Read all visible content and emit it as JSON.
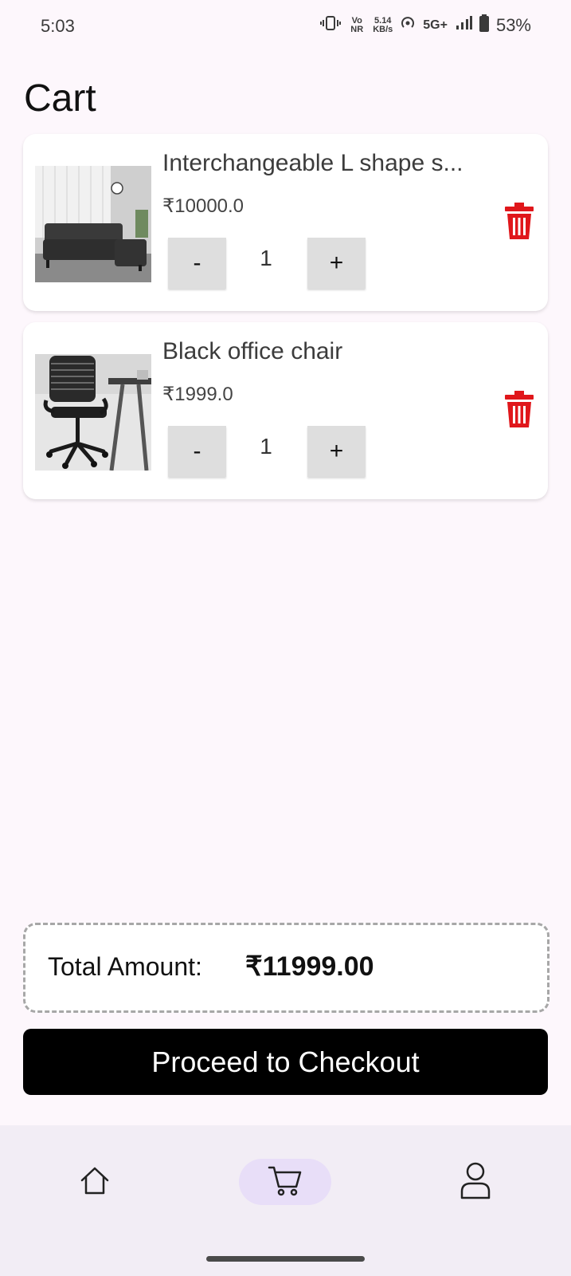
{
  "status_bar": {
    "time": "5:03",
    "volte": "Vo NR",
    "speed_value": "5.14",
    "speed_unit": "KB/s",
    "network": "5G+",
    "battery": "53%",
    "icons": [
      "vibrate-icon",
      "hotspot-icon",
      "signal-icon",
      "battery-icon"
    ]
  },
  "page": {
    "title": "Cart"
  },
  "cart": {
    "items": [
      {
        "name": "Interchangeable L shape s...",
        "price": "₹10000.0",
        "quantity": "1",
        "minus_label": "-",
        "plus_label": "+",
        "image": "sofa-photo"
      },
      {
        "name": "Black office chair",
        "price": "₹1999.0",
        "quantity": "1",
        "minus_label": "-",
        "plus_label": "+",
        "image": "office-chair-photo"
      }
    ]
  },
  "summary": {
    "total_label": "Total Amount:",
    "total_value": "₹11999.00"
  },
  "checkout": {
    "label": "Proceed to Checkout"
  },
  "nav": {
    "items": [
      {
        "icon": "home-icon",
        "active": false
      },
      {
        "icon": "cart-icon",
        "active": true
      },
      {
        "icon": "profile-icon",
        "active": false
      }
    ]
  },
  "colors": {
    "background": "#FDF7FC",
    "delete": "#E0171B",
    "nav_background": "#F2EDF5",
    "nav_active": "#E8DEF8",
    "checkout_button": "#000000"
  }
}
